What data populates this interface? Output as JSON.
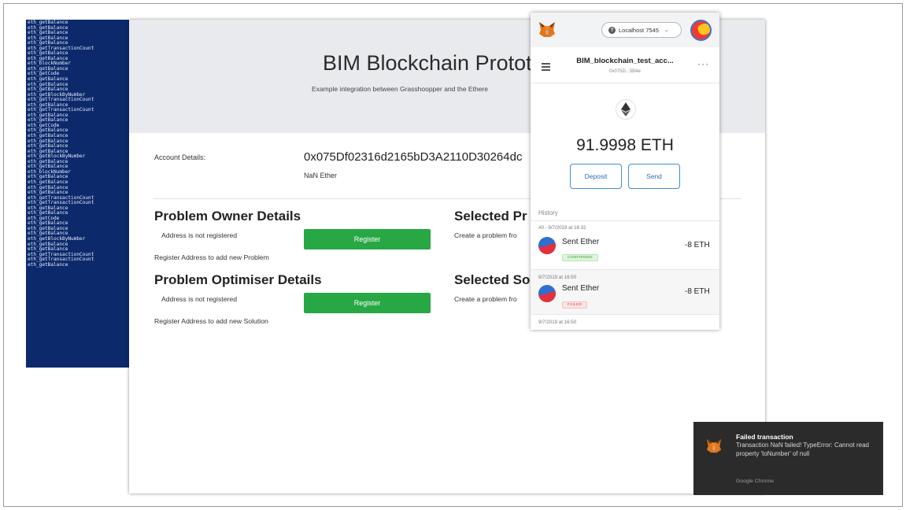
{
  "terminal": {
    "lines": [
      "eth_getBalance",
      "eth_getBalance",
      "eth_getBalance",
      "eth_getBalance",
      "eth_getBalance",
      "eth_getTransactionCount",
      "eth_getBalance",
      "eth_getBalance",
      "eth_blockNumber",
      "eth_getBalance",
      "eth_getCode",
      "eth_getBalance",
      "eth_getBalance",
      "eth_getBalance",
      "eth_getBlockByNumber",
      "eth_getTransactionCount",
      "eth_getBalance",
      "eth_getTransactionCount",
      "eth_getBalance",
      "eth_getBalance",
      "eth_getCode",
      "eth_getBalance",
      "eth_getBalance",
      "eth_getBalance",
      "eth_getBalance",
      "eth_getBalance",
      "eth_getBlockByNumber",
      "eth_getBalance",
      "eth_getBalance",
      "eth_blockNumber",
      "eth_getBalance",
      "eth_getBalance",
      "eth_getBalance",
      "eth_getBalance",
      "eth_getTransactionCount",
      "eth_getTransactionCount",
      "eth_getBalance",
      "eth_getBalance",
      "eth_getCode",
      "eth_getBalance",
      "eth_getBalance",
      "eth_getBalance",
      "eth_getBlockByNumber",
      "eth_getBalance",
      "eth_getBalance",
      "eth_getTransactionCount",
      "eth_getTransactionCount",
      "eth_getBalance"
    ]
  },
  "dapp": {
    "title": "BIM Blockchain Protot",
    "subtitle": "Example integration between Grasshoopper and the Ethere",
    "account_label": "Account Details:",
    "account_address": "0x075Df02316d2165bD3A2110D30264dc",
    "account_balance": "NaN Ether",
    "owner": {
      "heading": "Problem Owner Details",
      "status": "Address is not registered",
      "button": "Register",
      "hint": "Register Address to add new Problem"
    },
    "optimiser": {
      "heading": "Problem Optimiser Details",
      "status": "Address is not registered",
      "button": "Register",
      "hint": "Register Address to add new Solution"
    },
    "selected_problem": {
      "heading": "Selected Pr",
      "text": "Create a problem fro"
    },
    "selected_solution": {
      "heading": "Selected So",
      "text": "Create a problem fro"
    }
  },
  "metamask": {
    "network": "Localhost 7545",
    "account_name": "BIM_blockchain_test_acc...",
    "account_short": "0x075D...5B4e",
    "balance": "91.9998 ETH",
    "deposit_label": "Deposit",
    "send_label": "Send",
    "history_label": "History",
    "transactions": [
      {
        "date": "#0 - 9/7/2019 at 16:32",
        "title": "Sent Ether",
        "amount": "-8 ETH",
        "status": "CONFIRMED"
      },
      {
        "date": "9/7/2019 at 16:50",
        "title": "Sent Ether",
        "amount": "-8 ETH",
        "status": "FAILED"
      },
      {
        "date": "9/7/2019 at 16:50",
        "title": "",
        "amount": "",
        "status": ""
      }
    ],
    "colors": {
      "accent": "#3d8ddc",
      "confirmed": "#3e9b3e",
      "failed": "#d53b3b"
    }
  },
  "notification": {
    "title": "Failed transaction",
    "message": "Transaction NaN failed! TypeError: Cannot read property 'toNumber' of null",
    "source": "Google Chrome"
  },
  "colors": {
    "terminal_bg": "#0c2a6b",
    "register_button": "#28a745",
    "hero_bg": "#e8eaed"
  }
}
